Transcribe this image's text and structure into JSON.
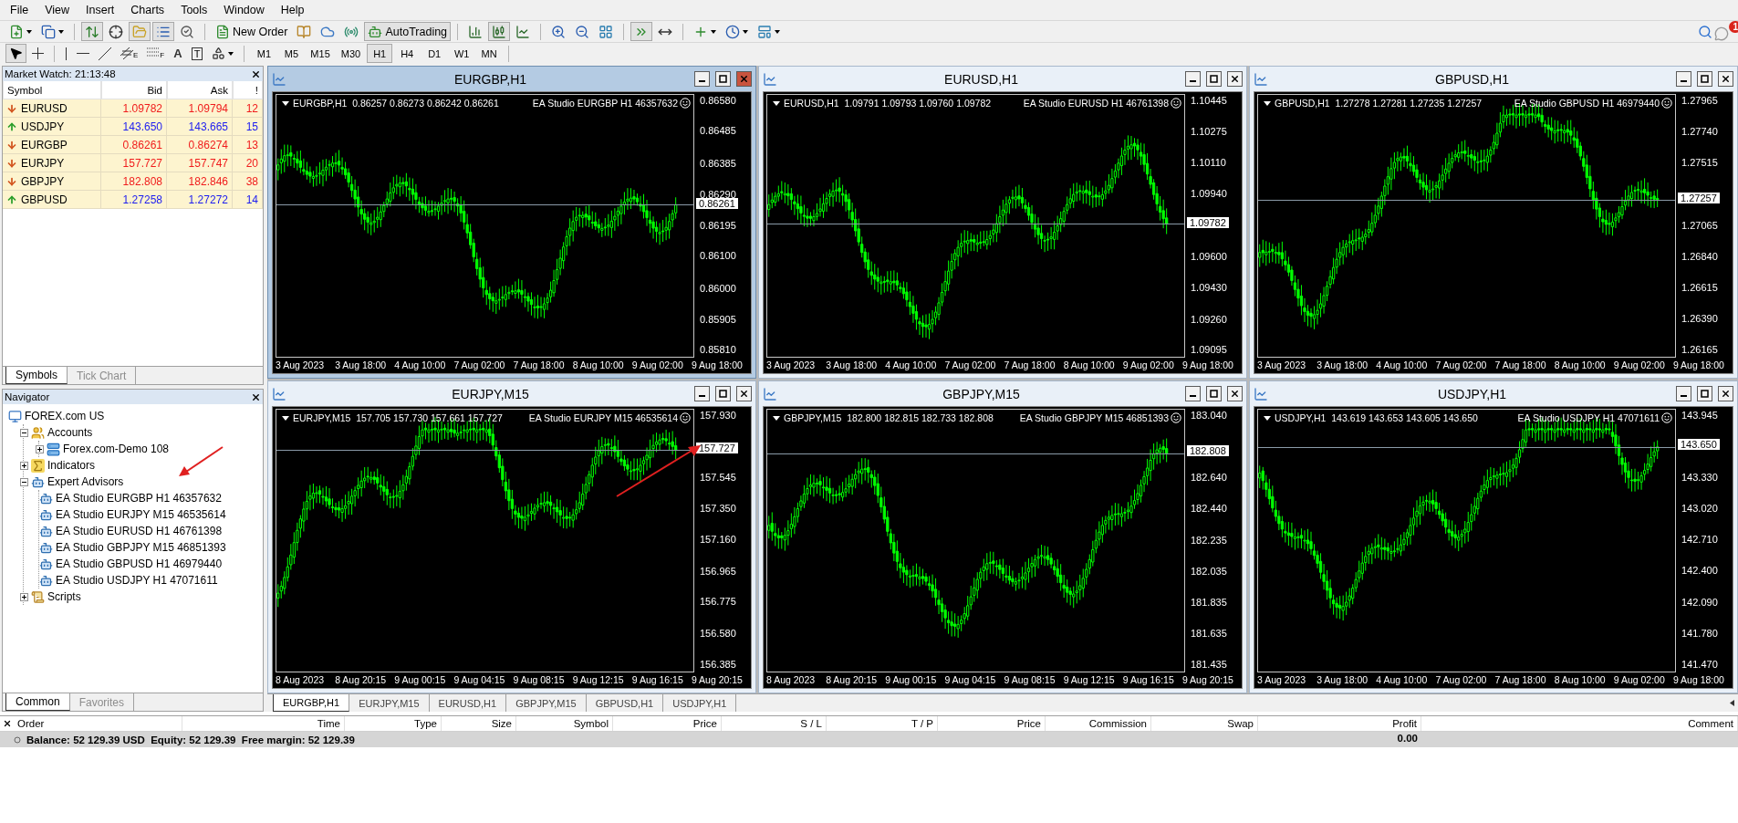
{
  "menu": [
    "File",
    "View",
    "Insert",
    "Charts",
    "Tools",
    "Window",
    "Help"
  ],
  "toolbar": [
    {
      "kind": "new-chart",
      "dropdown": true,
      "pressed": false
    },
    {
      "kind": "profiles",
      "dropdown": true,
      "pressed": false
    },
    {
      "kind": "separator"
    },
    {
      "kind": "market-watch",
      "pressed": true
    },
    {
      "kind": "data-window",
      "pressed": false
    },
    {
      "kind": "navigator",
      "pressed": true
    },
    {
      "kind": "terminal",
      "pressed": true
    },
    {
      "kind": "tester",
      "pressed": false
    },
    {
      "kind": "separator"
    },
    {
      "kind": "new-order",
      "label": "New Order",
      "pressed": false
    },
    {
      "kind": "editor",
      "pressed": false
    },
    {
      "kind": "account",
      "pressed": false
    },
    {
      "kind": "signals",
      "pressed": false
    },
    {
      "kind": "autotrading",
      "label": "AutoTrading",
      "pressed": true
    },
    {
      "kind": "separator"
    },
    {
      "kind": "bars",
      "pressed": false
    },
    {
      "kind": "candles",
      "pressed": true
    },
    {
      "kind": "line",
      "pressed": false
    },
    {
      "kind": "separator"
    },
    {
      "kind": "zoom-in",
      "pressed": false
    },
    {
      "kind": "zoom-out",
      "pressed": false
    },
    {
      "kind": "tile",
      "pressed": false
    },
    {
      "kind": "separator"
    },
    {
      "kind": "autoscroll",
      "pressed": true
    },
    {
      "kind": "shift",
      "pressed": false
    },
    {
      "kind": "separator"
    },
    {
      "kind": "indicators",
      "dropdown": true,
      "pressed": false
    },
    {
      "kind": "periods",
      "dropdown": true,
      "pressed": false
    },
    {
      "kind": "templates",
      "dropdown": true,
      "pressed": false
    }
  ],
  "notification_badge": "1",
  "tools": [
    {
      "kind": "cursor",
      "selected": true
    },
    {
      "kind": "crosshair",
      "selected": false
    },
    {
      "kind": "separator"
    },
    {
      "kind": "vline",
      "selected": false
    },
    {
      "kind": "hline",
      "selected": false
    },
    {
      "kind": "trend",
      "selected": false
    },
    {
      "kind": "channel",
      "label": "E",
      "selected": false
    },
    {
      "kind": "fibo",
      "label": "F",
      "selected": false
    },
    {
      "kind": "text",
      "label": "A",
      "selected": false
    },
    {
      "kind": "textlabel",
      "label": "T",
      "selected": false
    },
    {
      "kind": "shapes",
      "selected": false
    }
  ],
  "timeframes": [
    {
      "label": "M1",
      "selected": false
    },
    {
      "label": "M5",
      "selected": false
    },
    {
      "label": "M15",
      "selected": false
    },
    {
      "label": "M30",
      "selected": false
    },
    {
      "label": "H1",
      "selected": true
    },
    {
      "label": "H4",
      "selected": false
    },
    {
      "label": "D1",
      "selected": false
    },
    {
      "label": "W1",
      "selected": false
    },
    {
      "label": "MN",
      "selected": false
    }
  ],
  "market_watch": {
    "title": "Market Watch: 21:13:48",
    "columns": [
      "Symbol",
      "Bid",
      "Ask",
      "!"
    ],
    "rows": [
      {
        "symbol": "EURUSD",
        "bid": "1.09782",
        "ask": "1.09794",
        "spread": "12",
        "rising": false
      },
      {
        "symbol": "USDJPY",
        "bid": "143.650",
        "ask": "143.665",
        "spread": "15",
        "rising": true
      },
      {
        "symbol": "EURGBP",
        "bid": "0.86261",
        "ask": "0.86274",
        "spread": "13",
        "rising": false
      },
      {
        "symbol": "EURJPY",
        "bid": "157.727",
        "ask": "157.747",
        "spread": "20",
        "rising": false
      },
      {
        "symbol": "GBPJPY",
        "bid": "182.808",
        "ask": "182.846",
        "spread": "38",
        "rising": false
      },
      {
        "symbol": "GBPUSD",
        "bid": "1.27258",
        "ask": "1.27272",
        "spread": "14",
        "rising": true
      }
    ],
    "tabs": [
      {
        "label": "Symbols",
        "selected": true
      },
      {
        "label": "Tick Chart",
        "selected": false
      }
    ]
  },
  "navigator": {
    "title": "Navigator",
    "tree": [
      {
        "label": "FOREX.com US",
        "kind": "server",
        "children": [
          {
            "label": "Accounts",
            "kind": "accounts",
            "expanded": true,
            "children": [
              {
                "label": "Forex.com-Demo 108",
                "kind": "account",
                "expanded": false
              }
            ]
          },
          {
            "label": "Indicators",
            "kind": "indicators",
            "expanded": false
          },
          {
            "label": "Expert Advisors",
            "kind": "experts",
            "expanded": true,
            "children": [
              {
                "label": "EA Studio EURGBP H1 46357632",
                "kind": "expert"
              },
              {
                "label": "EA Studio EURJPY M15 46535614",
                "kind": "expert"
              },
              {
                "label": "EA Studio EURUSD H1 46761398",
                "kind": "expert"
              },
              {
                "label": "EA Studio GBPJPY M15 46851393",
                "kind": "expert"
              },
              {
                "label": "EA Studio GBPUSD H1 46979440",
                "kind": "expert"
              },
              {
                "label": "EA Studio USDJPY H1 47071611",
                "kind": "expert"
              }
            ]
          },
          {
            "label": "Scripts",
            "kind": "scripts",
            "expanded": false
          }
        ]
      }
    ],
    "tabs": [
      {
        "label": "Common",
        "selected": true
      },
      {
        "label": "Favorites",
        "selected": false
      }
    ]
  },
  "charts": [
    {
      "title": "EURGBP,H1",
      "selected": true,
      "quote": "EURGBP,H1  0.86257 0.86273 0.86242 0.86261",
      "expert": "EA Studio EURGBP H1 46357632",
      "price_ticks": [
        "0.86580",
        "0.86485",
        "0.86385",
        "0.86290",
        "0.86195",
        "0.86100",
        "0.86000",
        "0.85905",
        "0.85810"
      ],
      "current_price": "0.86261",
      "time_labels": [
        "3 Aug 2023",
        "3 Aug 18:00",
        "4 Aug 10:00",
        "7 Aug 02:00",
        "7 Aug 18:00",
        "8 Aug 10:00",
        "9 Aug 02:00",
        "9 Aug 18:00"
      ]
    },
    {
      "title": "EURUSD,H1",
      "selected": false,
      "quote": "EURUSD,H1  1.09791 1.09793 1.09760 1.09782",
      "expert": "EA Studio EURUSD H1 46761398",
      "price_ticks": [
        "1.10445",
        "1.10275",
        "1.10110",
        "1.09940",
        "1.09600",
        "1.09430",
        "1.09260",
        "1.09095"
      ],
      "current_price": "1.09782",
      "time_labels": [
        "3 Aug 2023",
        "3 Aug 18:00",
        "4 Aug 10:00",
        "7 Aug 02:00",
        "7 Aug 18:00",
        "8 Aug 10:00",
        "9 Aug 02:00",
        "9 Aug 18:00"
      ]
    },
    {
      "title": "GBPUSD,H1",
      "selected": false,
      "quote": "GBPUSD,H1  1.27278 1.27281 1.27235 1.27257",
      "expert": "EA Studio GBPUSD H1 46979440",
      "price_ticks": [
        "1.27965",
        "1.27740",
        "1.27515",
        "1.27065",
        "1.26840",
        "1.26615",
        "1.26390",
        "1.26165"
      ],
      "current_price": "1.27257",
      "time_labels": [
        "3 Aug 2023",
        "3 Aug 18:00",
        "4 Aug 10:00",
        "7 Aug 02:00",
        "7 Aug 18:00",
        "8 Aug 10:00",
        "9 Aug 02:00",
        "9 Aug 18:00"
      ]
    },
    {
      "title": "EURJPY,M15",
      "selected": false,
      "quote": "EURJPY,M15  157.705 157.730 157.661 157.727",
      "expert": "EA Studio EURJPY M15 46535614",
      "price_ticks": [
        "157.930",
        "157.545",
        "157.350",
        "157.160",
        "156.965",
        "156.775",
        "156.580",
        "156.385"
      ],
      "current_price": "157.727",
      "time_labels": [
        "8 Aug 2023",
        "8 Aug 20:15",
        "9 Aug 00:15",
        "9 Aug 04:15",
        "9 Aug 08:15",
        "9 Aug 12:15",
        "9 Aug 16:15",
        "9 Aug 20:15"
      ]
    },
    {
      "title": "GBPJPY,M15",
      "selected": false,
      "quote": "GBPJPY,M15  182.800 182.815 182.733 182.808",
      "expert": "EA Studio GBPJPY M15 46851393",
      "price_ticks": [
        "183.040",
        "182.640",
        "182.440",
        "182.235",
        "182.035",
        "181.835",
        "181.635",
        "181.435"
      ],
      "current_price": "182.808",
      "time_labels": [
        "8 Aug 2023",
        "8 Aug 20:15",
        "9 Aug 00:15",
        "9 Aug 04:15",
        "9 Aug 08:15",
        "9 Aug 12:15",
        "9 Aug 16:15",
        "9 Aug 20:15"
      ]
    },
    {
      "title": "USDJPY,H1",
      "selected": false,
      "quote": "USDJPY,H1  143.619 143.653 143.605 143.650",
      "expert": "EA Studio USDJPY H1 47071611",
      "price_ticks": [
        "143.945",
        "143.330",
        "143.020",
        "142.710",
        "142.400",
        "142.090",
        "141.780",
        "141.470"
      ],
      "current_price": "143.650",
      "time_labels": [
        "3 Aug 2023",
        "3 Aug 18:00",
        "4 Aug 10:00",
        "7 Aug 02:00",
        "7 Aug 18:00",
        "8 Aug 10:00",
        "9 Aug 02:00",
        "9 Aug 18:00"
      ]
    }
  ],
  "chart_tabs": [
    {
      "label": "EURGBP,H1",
      "selected": true
    },
    {
      "label": "EURJPY,M15",
      "selected": false
    },
    {
      "label": "EURUSD,H1",
      "selected": false
    },
    {
      "label": "GBPJPY,M15",
      "selected": false
    },
    {
      "label": "GBPUSD,H1",
      "selected": false
    },
    {
      "label": "USDJPY,H1",
      "selected": false
    }
  ],
  "terminal": {
    "columns": [
      "Order",
      "Time",
      "Type",
      "Size",
      "Symbol",
      "Price",
      "S / L",
      "T / P",
      "Price",
      "Commission",
      "Swap",
      "Profit",
      "Comment"
    ],
    "summary": "Balance: 52 129.39 USD  Equity: 52 129.39  Free margin: 52 129.39",
    "profit": "0.00"
  }
}
